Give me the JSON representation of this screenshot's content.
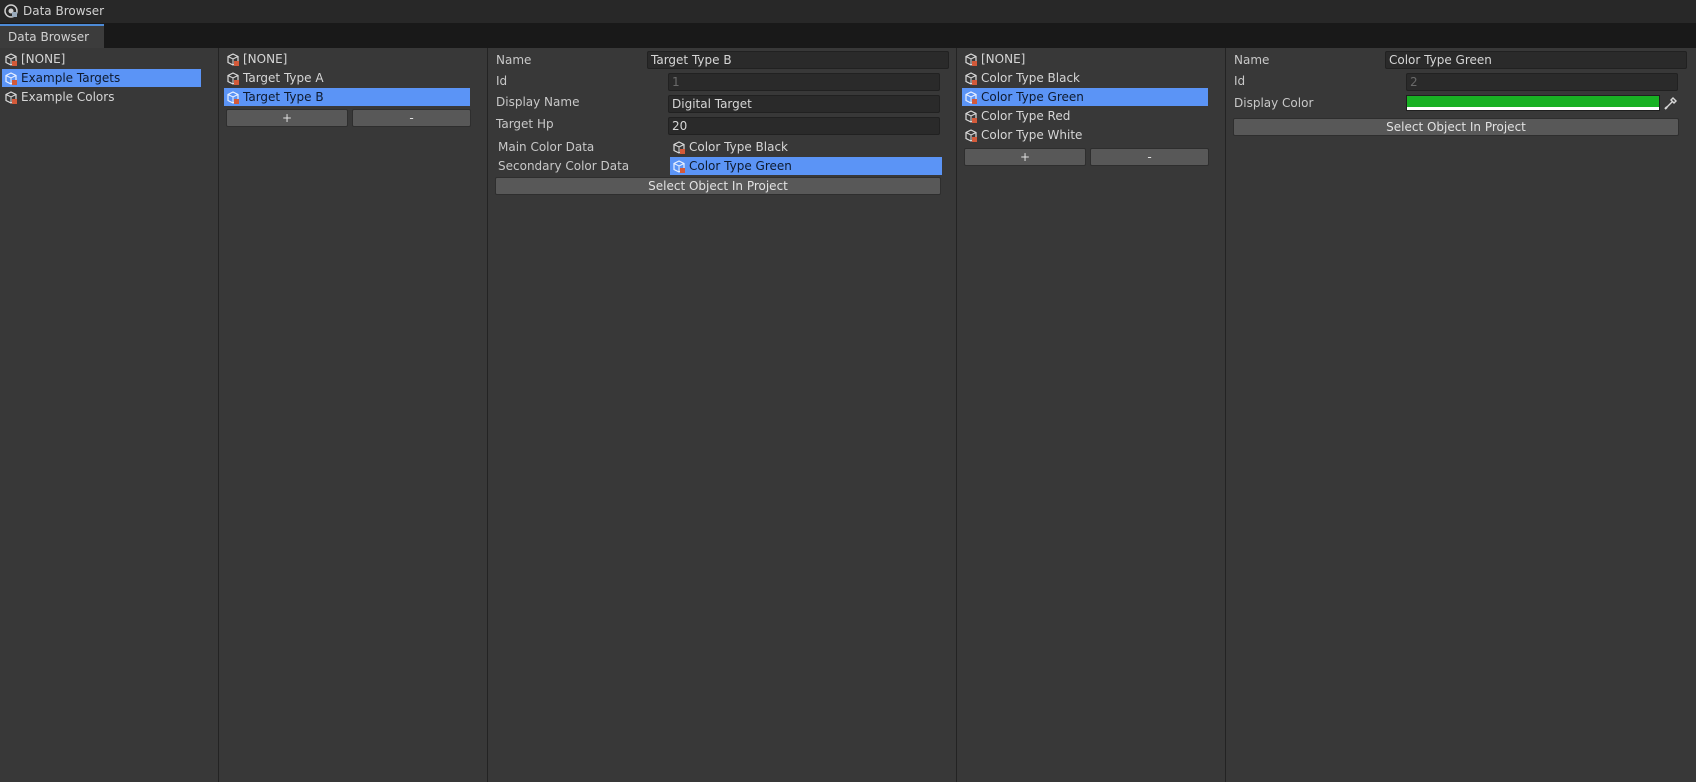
{
  "window": {
    "title": "Data Browser",
    "tab": "Data Browser"
  },
  "colors": {
    "selection": "#5b94f6",
    "display_color": "#19b124"
  },
  "categories": {
    "items": [
      {
        "label": "[NONE]",
        "selected": false,
        "icon": "data-asset-icon"
      },
      {
        "label": "Example Targets",
        "selected": true,
        "icon": "data-asset-icon"
      },
      {
        "label": "Example Colors",
        "selected": false,
        "icon": "data-asset-icon"
      }
    ]
  },
  "targets": {
    "items": [
      {
        "label": "[NONE]",
        "selected": false
      },
      {
        "label": "Target Type A",
        "selected": false
      },
      {
        "label": "Target Type B",
        "selected": true
      }
    ],
    "add_label": "+",
    "remove_label": "-"
  },
  "target_inspector": {
    "name_label": "Name",
    "name_value": "Target Type B",
    "id_label": "Id",
    "id_value": "1",
    "display_name_label": "Display Name",
    "display_name_value": "Digital Target",
    "hp_label": "Target Hp",
    "hp_value": "20",
    "main_color_label": "Main Color Data",
    "main_color_value": "Color Type Black",
    "secondary_color_label": "Secondary Color Data",
    "secondary_color_value": "Color Type Green",
    "select_button": "Select Object In Project"
  },
  "colors_list": {
    "items": [
      {
        "label": "[NONE]",
        "selected": false
      },
      {
        "label": "Color Type Black",
        "selected": false
      },
      {
        "label": "Color Type Green",
        "selected": true
      },
      {
        "label": "Color Type Red",
        "selected": false
      },
      {
        "label": "Color Type White",
        "selected": false
      }
    ],
    "add_label": "+",
    "remove_label": "-"
  },
  "color_inspector": {
    "name_label": "Name",
    "name_value": "Color Type Green",
    "id_label": "Id",
    "id_value": "2",
    "display_color_label": "Display Color",
    "select_button": "Select Object In Project"
  }
}
